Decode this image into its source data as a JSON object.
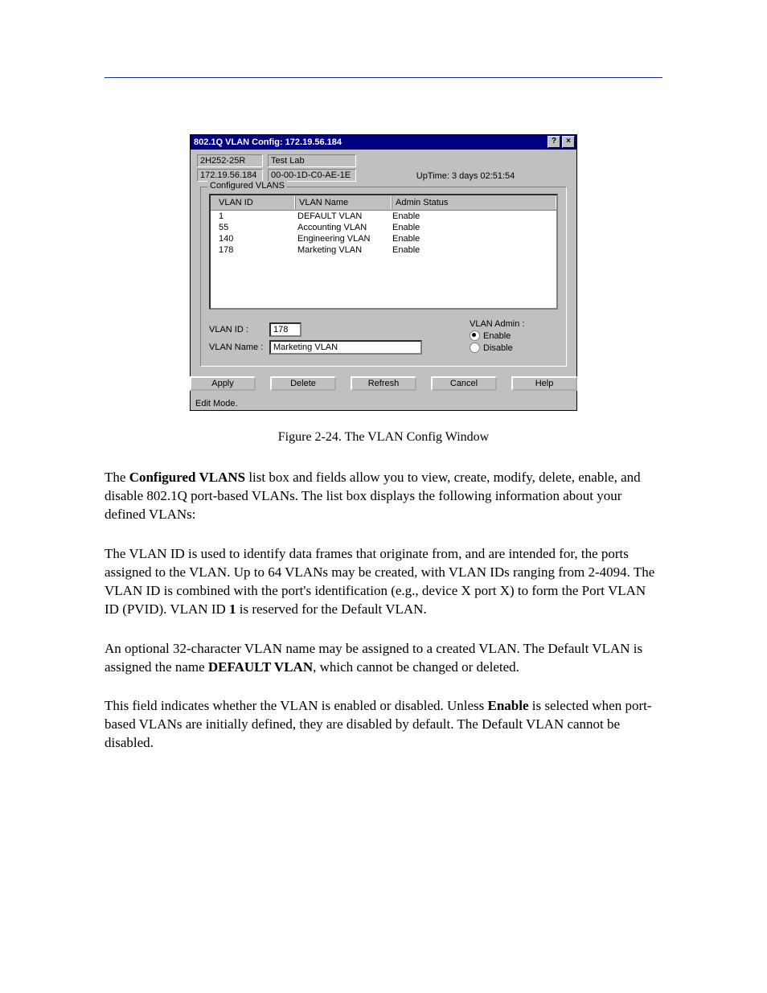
{
  "dialog": {
    "title": "802.1Q VLAN Config: 172.19.56.184",
    "help_btn": "?",
    "close_btn": "×",
    "device_model": "2H252-25R",
    "device_location": "Test Lab",
    "device_ip": "172.19.56.184",
    "device_mac": "00-00-1D-C0-AE-1E",
    "uptime_label": "UpTime: 3 days 02:51:54",
    "group_legend": "Configured VLANS",
    "col_id": "VLAN ID",
    "col_name": "VLAN Name",
    "col_status": "Admin Status",
    "rows": [
      {
        "id": "1",
        "name": "DEFAULT VLAN",
        "status": "Enable"
      },
      {
        "id": "55",
        "name": "Accounting VLAN",
        "status": "Enable"
      },
      {
        "id": "140",
        "name": "Engineering VLAN",
        "status": "Enable"
      },
      {
        "id": "178",
        "name": "Marketing VLAN",
        "status": "Enable"
      }
    ],
    "vlan_id_label": "VLAN ID :",
    "vlan_id_value": "178",
    "vlan_name_label": "VLAN Name :",
    "vlan_name_value": "Marketing VLAN",
    "admin_label": "VLAN Admin :",
    "enable_label": "Enable",
    "disable_label": "Disable",
    "buttons": {
      "apply": "Apply",
      "delete": "Delete",
      "refresh": "Refresh",
      "cancel": "Cancel",
      "help": "Help"
    },
    "status_text": "Edit Mode."
  },
  "text": {
    "caption": "Figure 2-24.  The VLAN Config Window",
    "p1a": "The ",
    "p1b": "Configured VLANS",
    "p1c": " list box and fields allow you to view, create, modify, delete, enable, and disable 802.1Q port-based VLANs. The list box displays the following information about your defined VLANs:",
    "p2a": "The VLAN ID is used to identify data frames that originate from, and are intended for, the ports assigned to the VLAN. Up to 64 VLANs may be created, with VLAN IDs ranging from 2-4094. The VLAN ID is combined with the port's identification (e.g., device X port X) to form the Port VLAN ID (PVID). VLAN ID ",
    "p2b": "1",
    "p2c": " is reserved for the Default VLAN.",
    "p3a": "An optional 32-character VLAN name may be assigned to a created VLAN. The Default VLAN is assigned the name ",
    "p3b": "DEFAULT VLAN",
    "p3c": ", which cannot be changed or deleted.",
    "p4a": "This field indicates whether the VLAN is enabled or disabled. Unless ",
    "p4b": "Enable",
    "p4c": " is selected when port-based VLANs are initially defined, they are disabled by default. The Default VLAN cannot be disabled."
  }
}
